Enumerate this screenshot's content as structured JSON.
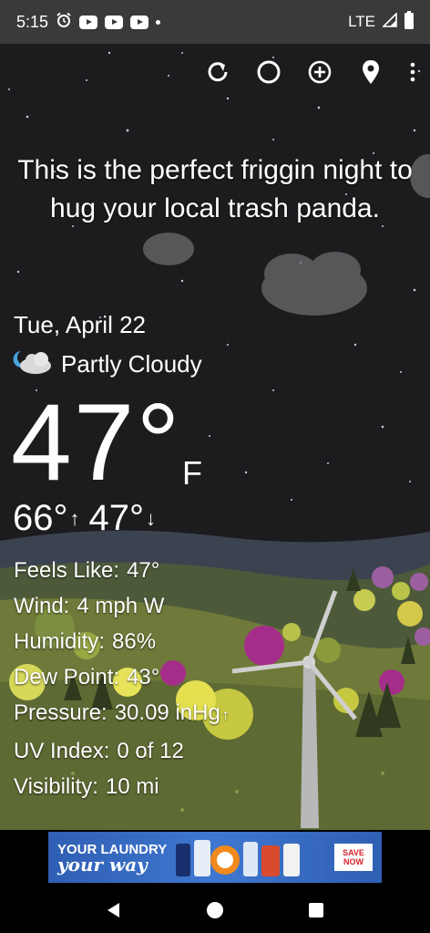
{
  "status_bar": {
    "time": "5:15",
    "network": "LTE",
    "icons": [
      "alarm-icon",
      "youtube-icon",
      "youtube-icon",
      "youtube-icon",
      "notification-dot",
      "signal-icon",
      "battery-icon"
    ]
  },
  "toolbar": {
    "icons": [
      "refresh-icon",
      "theme-icon",
      "add-location-icon",
      "location-pin-icon",
      "overflow-menu-icon"
    ]
  },
  "quote": "This is the perfect friggin night to hug your local trash panda.",
  "weather": {
    "date": "Tue, April 22",
    "condition": "Partly Cloudy",
    "condition_icon": "partly-cloudy-night-icon",
    "temperature": "47°",
    "unit": "F",
    "high": "66°",
    "low": "47°",
    "details": [
      {
        "label": "Feels Like:",
        "value": "47°"
      },
      {
        "label": "Wind:",
        "value": "4 mph W"
      },
      {
        "label": "Humidity:",
        "value": "86%"
      },
      {
        "label": "Dew Point:",
        "value": "43°"
      },
      {
        "label": "Pressure:",
        "value": "30.09 inHg"
      },
      {
        "label": "UV Index:",
        "value": "0 of 12"
      },
      {
        "label": "Visibility:",
        "value": "10 mi"
      }
    ]
  },
  "ad": {
    "line1": "YOUR LAUNDRY",
    "line2": "your way",
    "cta": "SAVE NOW"
  },
  "nav": {
    "icons": [
      "back-icon",
      "home-icon",
      "recents-icon"
    ]
  },
  "colors": {
    "sky": "#1c1c1f",
    "hills": "#6f7a3a",
    "ad_blue": "#3f77d0",
    "status_bg": "#3a3a3a"
  }
}
